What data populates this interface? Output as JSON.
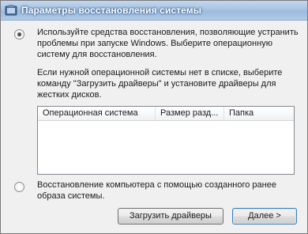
{
  "window": {
    "title": "Параметры восстановления системы"
  },
  "icons": {
    "title_icon": "system-recovery-icon"
  },
  "option_restore_tools": {
    "selected": true,
    "lines": [
      "Используйте средства восстановления, позволяющие устранить",
      "проблемы при запуске Windows. Выберите операционную",
      "систему для восстановления."
    ]
  },
  "drivers_note": {
    "lines": [
      "Если нужной операционной системы нет в списке, выберите",
      "команду \"Загрузить драйверы\" и установите драйверы для",
      "жестких дисков."
    ]
  },
  "os_list": {
    "columns": [
      "Операционная система",
      "Размер разд...",
      "Папка"
    ],
    "rows": []
  },
  "option_system_image": {
    "selected": false,
    "lines": [
      "Восстановление компьютера с помощью созданного ранее",
      "образа системы."
    ]
  },
  "buttons": {
    "load_drivers": "Загрузить драйверы",
    "next": "Далее >"
  },
  "colors": {
    "titlebar": "#a9c4e2",
    "dialog_background": "#f0f0f0",
    "default_button_border": "#3c7fb1"
  }
}
